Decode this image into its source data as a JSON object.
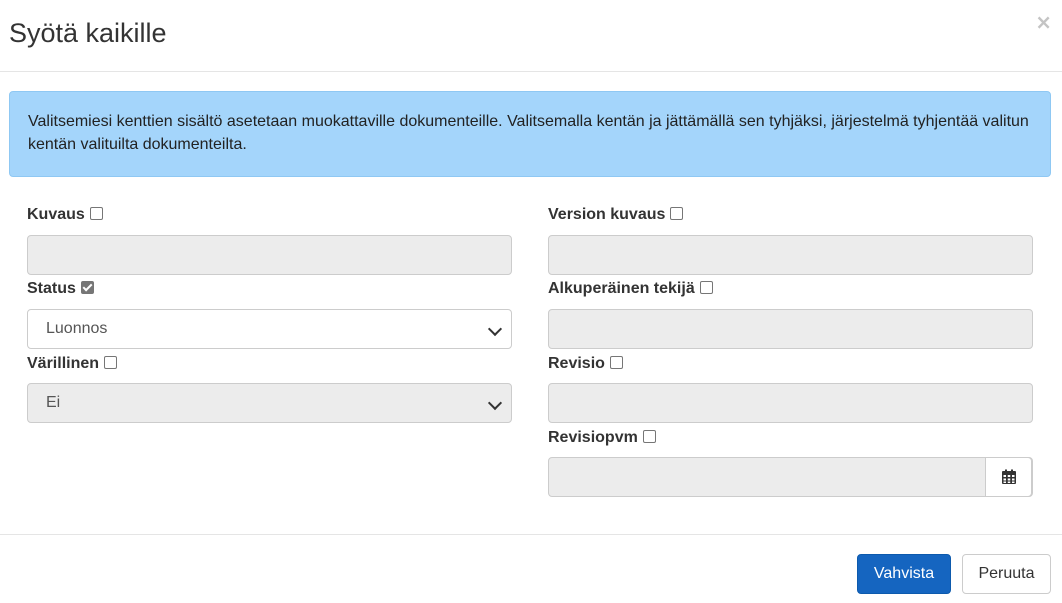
{
  "dialog": {
    "title": "Syötä kaikille",
    "close_glyph": "×"
  },
  "alert": {
    "text": "Valitsemiesi kenttien sisältö asetetaan muokattaville dokumenteille. Valitsemalla kentän ja jättämällä sen tyhjäksi, järjestelmä tyhjentää valitun kentän valituilta dokumenteilta.",
    "background": "#a4d5fb"
  },
  "fields": {
    "kuvaus": {
      "label": "Kuvaus",
      "checked": false,
      "value": ""
    },
    "status": {
      "label": "Status",
      "checked": true,
      "value": "Luonnos"
    },
    "varillinen": {
      "label": "Värillinen",
      "checked": false,
      "value": "Ei"
    },
    "version_kuvaus": {
      "label": "Version kuvaus",
      "checked": false,
      "value": ""
    },
    "alkuperainen_tekija": {
      "label": "Alkuperäinen tekijä",
      "checked": false,
      "value": ""
    },
    "revisio": {
      "label": "Revisio",
      "checked": false,
      "value": ""
    },
    "revisiopvm": {
      "label": "Revisiopvm",
      "checked": false,
      "value": "",
      "icon": "calendar-icon"
    }
  },
  "footer": {
    "confirm_label": "Vahvista",
    "cancel_label": "Peruuta",
    "primary_color": "#1565c0"
  }
}
